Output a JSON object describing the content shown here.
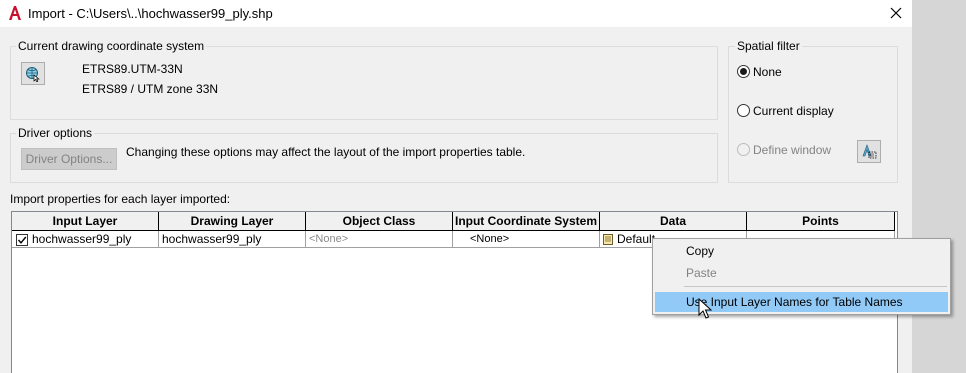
{
  "window": {
    "title": "Import - C:\\Users\\..\\hochwasser99_ply.shp",
    "app_icon": "autocad-a-icon",
    "close_icon": "close-icon"
  },
  "coordinate_system": {
    "legend": "Current drawing coordinate system",
    "code": "ETRS89.UTM-33N",
    "description": "ETRS89 / UTM zone 33N",
    "button_icon": "globe-cursor-icon"
  },
  "driver_options": {
    "legend": "Driver options",
    "button_label": "Driver Options...",
    "note": "Changing these options may affect the layout of the import properties table."
  },
  "spatial_filter": {
    "legend": "Spatial filter",
    "options": [
      {
        "label": "None",
        "selected": true,
        "enabled": true
      },
      {
        "label": "Current display",
        "selected": false,
        "enabled": true
      },
      {
        "label": "Define window",
        "selected": false,
        "enabled": false
      }
    ],
    "window_button_icon": "select-window-icon"
  },
  "import_table": {
    "caption": "Import properties for each layer imported:",
    "columns": [
      "Input Layer",
      "Drawing Layer",
      "Object Class",
      "Input Coordinate System",
      "Data",
      "Points"
    ],
    "rows": [
      {
        "checked": true,
        "input_layer": "hochwasser99_ply",
        "drawing_layer": "hochwasser99_ply",
        "object_class": "<None>",
        "input_coordinate_system": "<None>",
        "data": "Default",
        "points": ""
      }
    ]
  },
  "context_menu": {
    "items": [
      {
        "label": "Copy",
        "enabled": true,
        "highlighted": false
      },
      {
        "label": "Paste",
        "enabled": false,
        "highlighted": false
      },
      {
        "label": "Use Input Layer Names for Table Names",
        "enabled": true,
        "highlighted": true
      }
    ]
  },
  "colors": {
    "highlight": "#91c9f7",
    "dialog_bg": "#f0f0f0",
    "app_red": "#c8102e"
  }
}
